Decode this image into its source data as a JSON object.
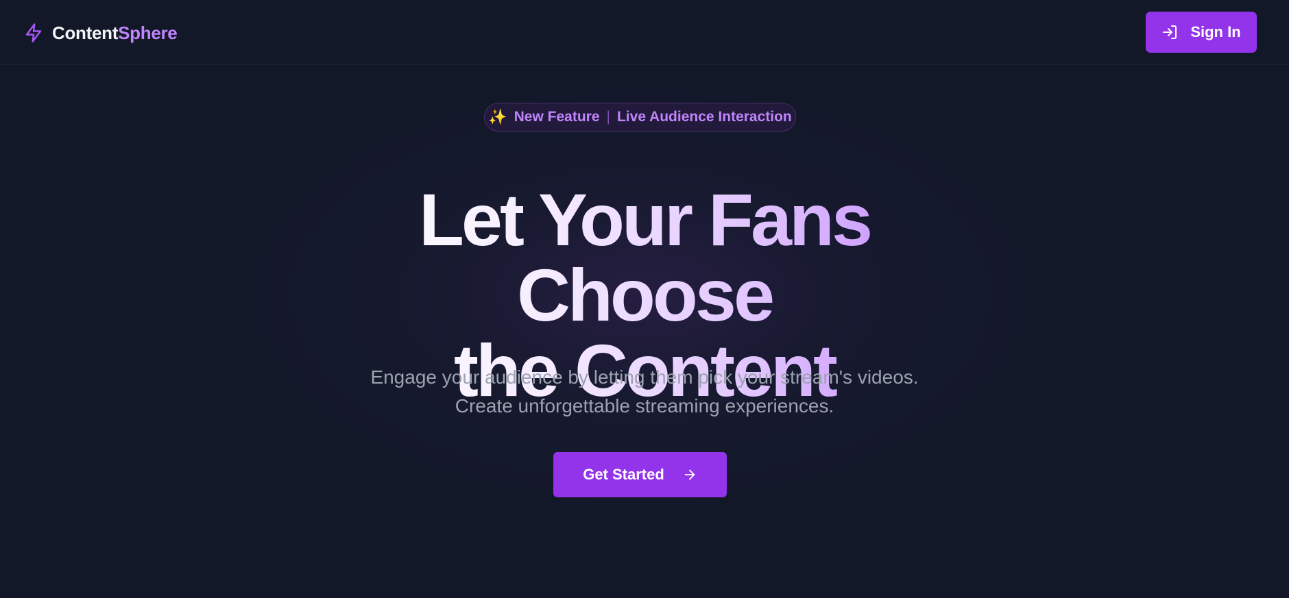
{
  "header": {
    "brand_first": "Content",
    "brand_second": "Sphere",
    "brand_icon": "lightning-bolt-icon",
    "sign_in_label": "Sign In",
    "sign_in_icon": "log-in-icon"
  },
  "badge": {
    "sparkle": "✨",
    "label": "New Feature",
    "divider": "|",
    "text": "Live Audience Interaction"
  },
  "hero": {
    "headline_line1": "Let Your Fans Choose",
    "headline_line2": "the Content",
    "subtitle_line1": "Engage your audience by letting them pick your stream's videos.",
    "subtitle_line2": "Create unforgettable streaming experiences.",
    "cta_label": "Get Started",
    "cta_icon": "arrow-right-icon"
  },
  "colors": {
    "background": "#121828",
    "accent": "#9333ea",
    "accent_light": "#c084fc",
    "muted_text": "#9ca3af"
  }
}
